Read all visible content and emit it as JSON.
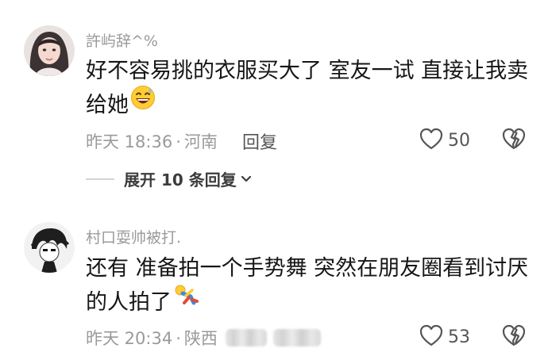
{
  "comments": [
    {
      "username": "許屿辞^%",
      "text": "好不容易挑的衣服买大了 室友一试 直接让我卖给她",
      "emoji": "grinning-sweat-emoji",
      "time": "昨天 18:36",
      "location": "河南",
      "reply_label": "回复",
      "likes": "50",
      "expand_label": "展开 10 条回复"
    },
    {
      "username": "村口耍帅被打.",
      "text": "还有 准备拍一个手势舞 突然在朋友圈看到讨厌的人拍了",
      "emoji": "falling-person-emoji",
      "time": "昨天 20:34",
      "location": "陕西",
      "likes": "53"
    }
  ],
  "separator": "·",
  "colors": {
    "meta_gray": "#9a9a9a",
    "text": "#161616",
    "icon_gray": "#555555"
  }
}
